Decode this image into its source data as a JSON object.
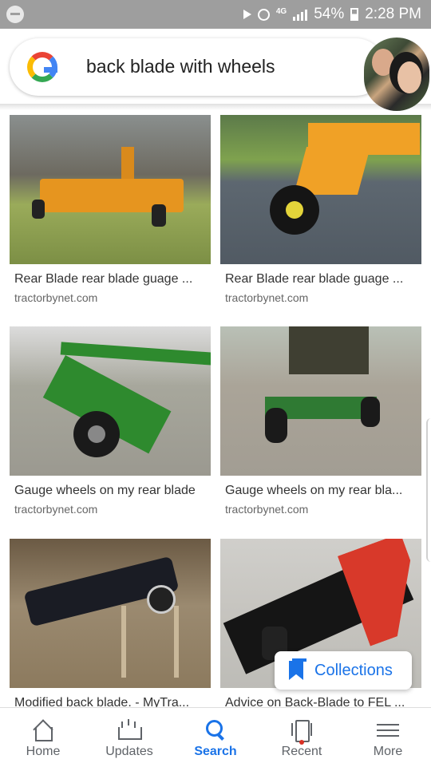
{
  "status_bar": {
    "battery": "54%",
    "time": "2:28 PM",
    "network": "4G"
  },
  "search": {
    "query": "back blade with wheels"
  },
  "results": [
    {
      "title": "Rear Blade rear blade guage ...",
      "source": "tractorbynet.com"
    },
    {
      "title": "Rear Blade rear blade guage ...",
      "source": "tractorbynet.com"
    },
    {
      "title": "Gauge wheels on my rear blade",
      "source": "tractorbynet.com"
    },
    {
      "title": "Gauge wheels on my rear bla...",
      "source": "tractorbynet.com"
    },
    {
      "title": "Modified back blade. - MyTra...",
      "source": ""
    },
    {
      "title": "Advice on Back-Blade to FEL ...",
      "source": ""
    }
  ],
  "collections_button": {
    "label": "Collections"
  },
  "bottom_nav": [
    {
      "label": "Home",
      "icon": "home-icon"
    },
    {
      "label": "Updates",
      "icon": "updates-icon"
    },
    {
      "label": "Search",
      "icon": "search-icon"
    },
    {
      "label": "Recent",
      "icon": "recent-icon"
    },
    {
      "label": "More",
      "icon": "more-icon"
    }
  ],
  "colors": {
    "accent": "#1a73e8",
    "status_bar": "#9e9e9e"
  }
}
